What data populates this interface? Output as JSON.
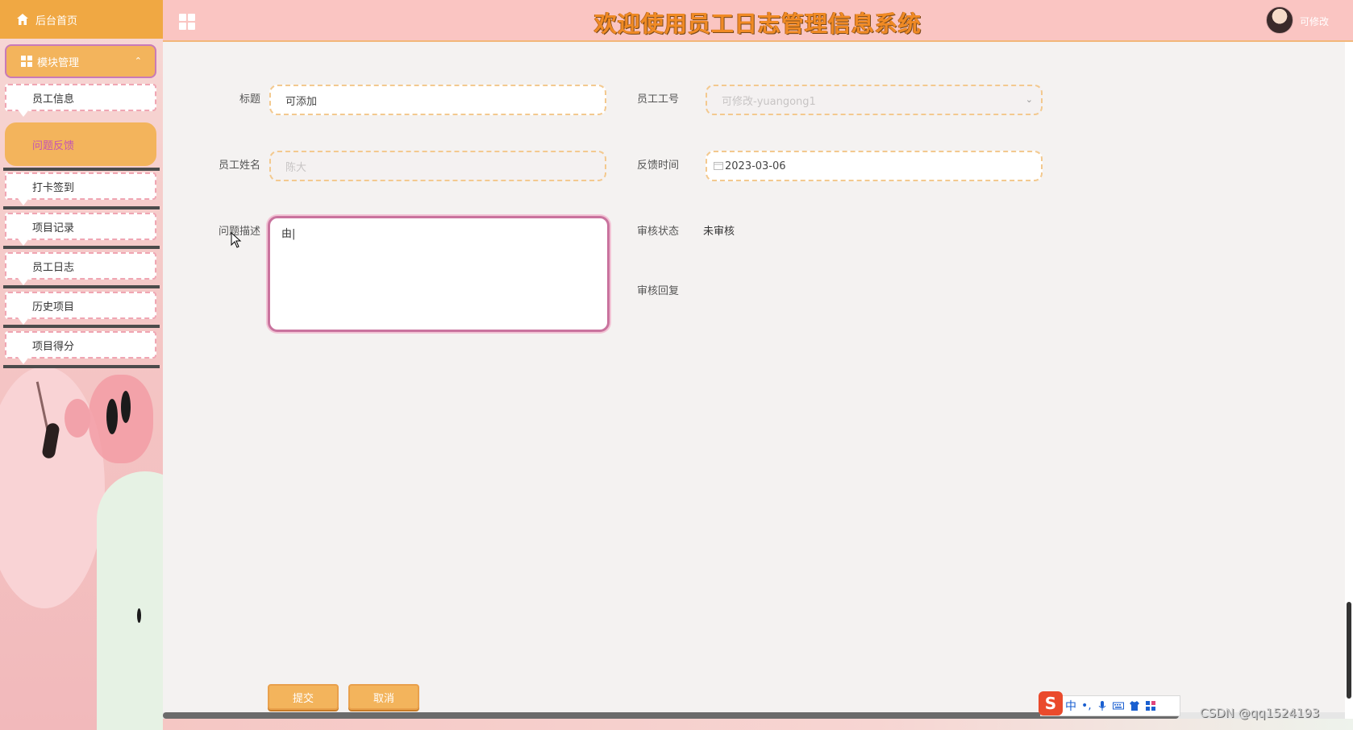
{
  "app": {
    "title": "欢迎使用员工日志管理信息系统",
    "user_name": "可修改"
  },
  "sidebar": {
    "home_label": "后台首页",
    "module_label": "模块管理",
    "items": [
      {
        "label": "员工信息"
      },
      {
        "label": "问题反馈",
        "active": true
      },
      {
        "label": "打卡签到"
      },
      {
        "label": "项目记录"
      },
      {
        "label": "员工日志"
      },
      {
        "label": "历史项目"
      },
      {
        "label": "项目得分"
      }
    ]
  },
  "form": {
    "title_label": "标题",
    "title_value": "可添加",
    "emp_no_label": "员工工号",
    "emp_no_value": "可修改-yuangong1",
    "emp_name_label": "员工姓名",
    "emp_name_value": "陈大",
    "feedback_time_label": "反馈时间",
    "feedback_time_value": "2023-03-06",
    "description_label": "问题描述",
    "description_value": "由|",
    "review_status_label": "审核状态",
    "review_status_value": "未审核",
    "review_reply_label": "审核回复",
    "submit_label": "提交",
    "cancel_label": "取消"
  },
  "taskbar": {
    "ime_logo": "S",
    "ime_mode": "中",
    "ime_punct": "•,",
    "watermark": "CSDN @qq1524193"
  },
  "colors": {
    "accent_orange": "#f3b45c",
    "topbar_pink": "#fac5c2",
    "active_text": "#c455b3"
  }
}
